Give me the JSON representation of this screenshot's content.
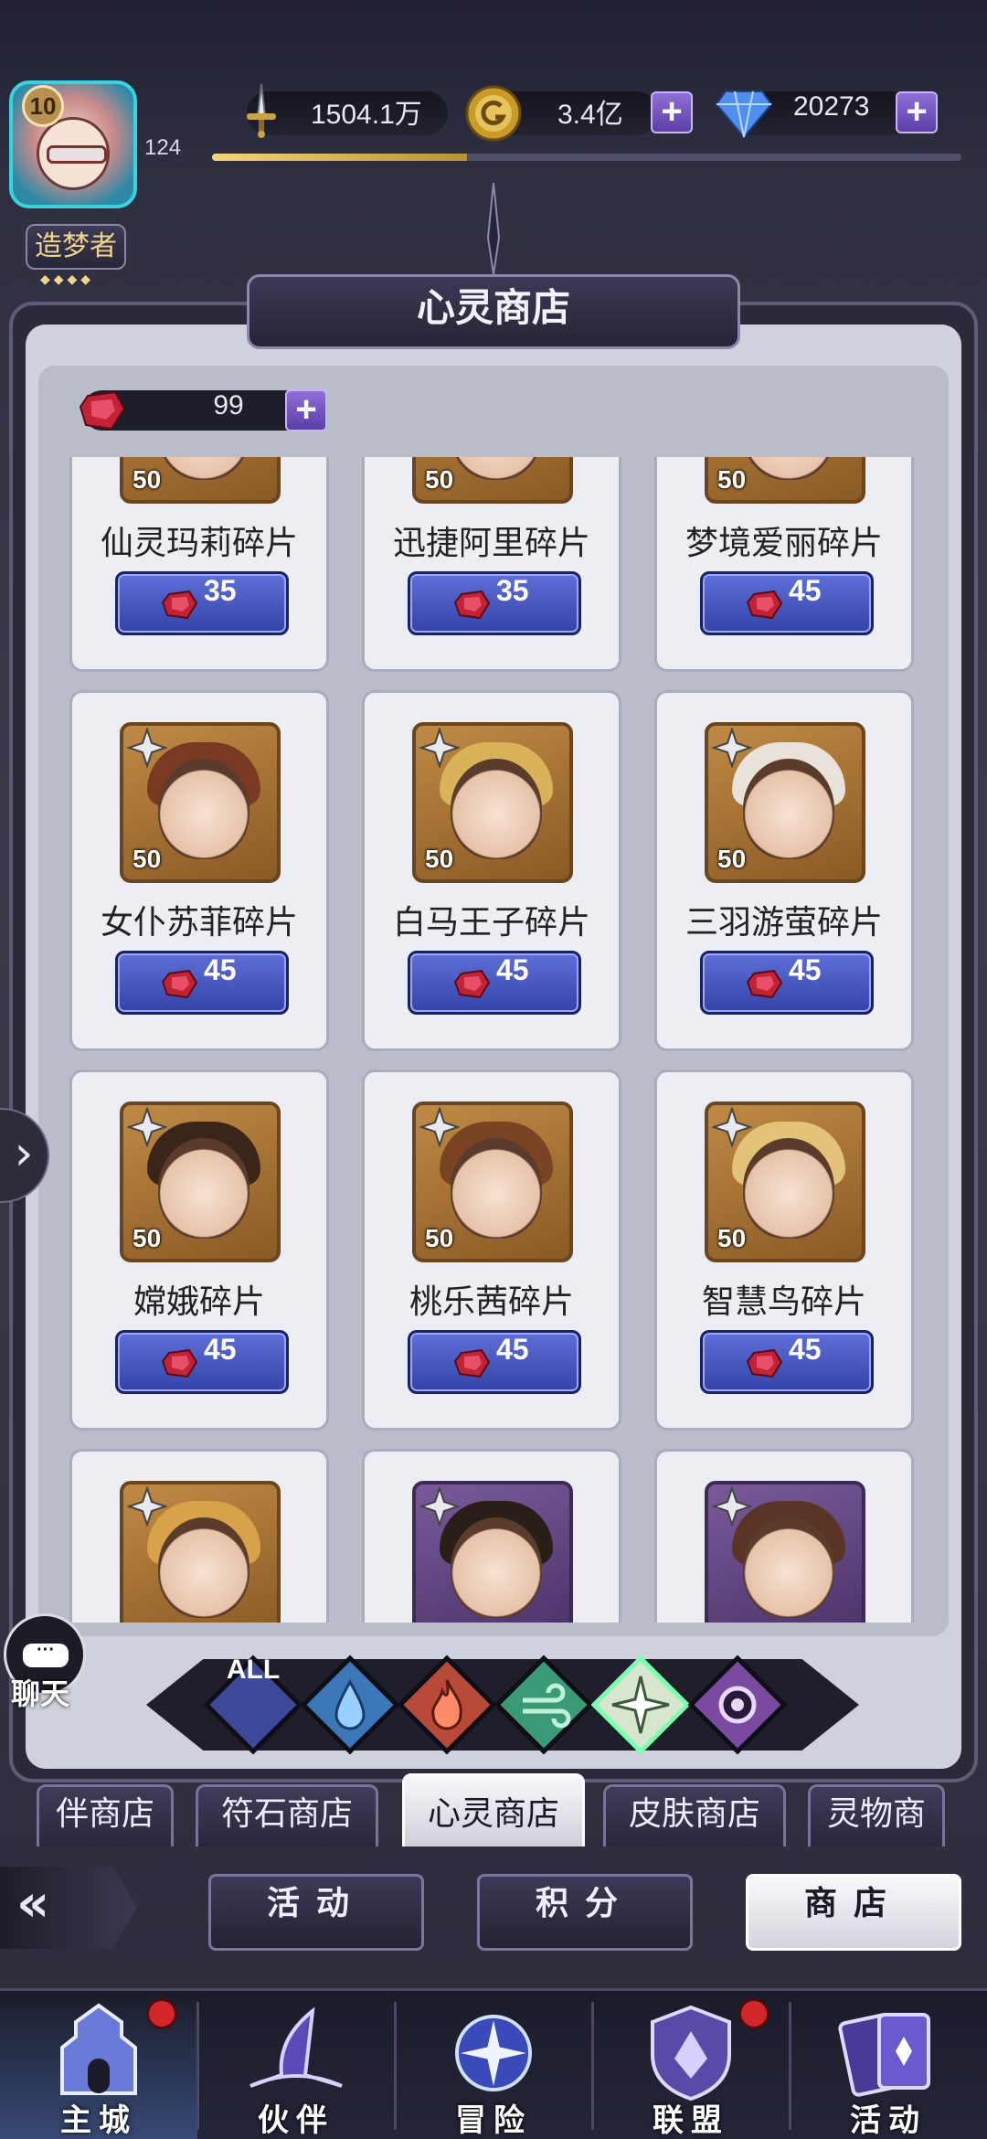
{
  "header": {
    "level": "10",
    "player_number": "124",
    "title_tag": "造梦者",
    "exp_fraction": 0.34,
    "resources": [
      {
        "name": "power",
        "icon": "sword-icon",
        "value": "1504.1万"
      },
      {
        "name": "gold",
        "icon": "gold-coin-icon",
        "value": "3.4亿"
      },
      {
        "name": "diamond",
        "icon": "diamond-icon",
        "value": "20273"
      }
    ]
  },
  "shop": {
    "title": "心灵商店",
    "currency_value": "99",
    "items": [
      {
        "name": "仙灵玛莉碎片",
        "count": "50",
        "price": "35",
        "frame": "gold",
        "hair": "#2d2a2a"
      },
      {
        "name": "迅捷阿里碎片",
        "count": "50",
        "price": "35",
        "frame": "gold",
        "hair": "#c9b38a"
      },
      {
        "name": "梦境爱丽碎片",
        "count": "50",
        "price": "45",
        "frame": "gold",
        "hair": "#5a2a1c"
      },
      {
        "name": "女仆苏菲碎片",
        "count": "50",
        "price": "45",
        "frame": "gold",
        "hair": "#7a3a22"
      },
      {
        "name": "白马王子碎片",
        "count": "50",
        "price": "45",
        "frame": "gold",
        "hair": "#d9b25a"
      },
      {
        "name": "三羽游萤碎片",
        "count": "50",
        "price": "45",
        "frame": "gold",
        "hair": "#e8e2da"
      },
      {
        "name": "嫦娥碎片",
        "count": "50",
        "price": "45",
        "frame": "gold",
        "hair": "#3b2418"
      },
      {
        "name": "桃乐茜碎片",
        "count": "50",
        "price": "45",
        "frame": "gold",
        "hair": "#7a4424"
      },
      {
        "name": "智慧鸟碎片",
        "count": "50",
        "price": "45",
        "frame": "gold",
        "hair": "#e3c27a"
      },
      {
        "name": "",
        "count": "",
        "price": "",
        "frame": "gold",
        "hair": "#d8a24a"
      },
      {
        "name": "",
        "count": "",
        "price": "",
        "frame": "purple",
        "hair": "#2a1e18"
      },
      {
        "name": "",
        "count": "",
        "price": "",
        "frame": "purple",
        "hair": "#5a3424"
      }
    ]
  },
  "element_filters": [
    {
      "key": "all",
      "label": "ALL",
      "color": "#3d4a9a"
    },
    {
      "key": "water",
      "label": "",
      "color": "#3a78b8"
    },
    {
      "key": "fire",
      "label": "",
      "color": "#b84a3a"
    },
    {
      "key": "wind",
      "label": "",
      "color": "#3a9a78"
    },
    {
      "key": "light",
      "label": "",
      "color": "#d8e6d0"
    },
    {
      "key": "dark",
      "label": "",
      "color": "#7a4aa0"
    }
  ],
  "shop_tabs": [
    "伴商店",
    "符石商店",
    "心灵商店",
    "皮肤商店",
    "灵物商"
  ],
  "active_shop_tab": 2,
  "categories": [
    {
      "label": "活动"
    },
    {
      "label": "积分"
    },
    {
      "label": "商店"
    }
  ],
  "chat": {
    "label": "聊天"
  },
  "bottom_nav": [
    {
      "label": "主城",
      "icon": "castle-icon",
      "badge": true
    },
    {
      "label": "伙伴",
      "icon": "witch-hat-icon",
      "badge": false
    },
    {
      "label": "冒险",
      "icon": "compass-orb-icon",
      "badge": false
    },
    {
      "label": "联盟",
      "icon": "shield-icon",
      "badge": true
    },
    {
      "label": "活动",
      "icon": "cards-icon",
      "badge": false
    }
  ],
  "colors": {
    "accent": "#5f6fd8",
    "panel": "#cfd1dc",
    "badge_red": "#d3262b"
  }
}
